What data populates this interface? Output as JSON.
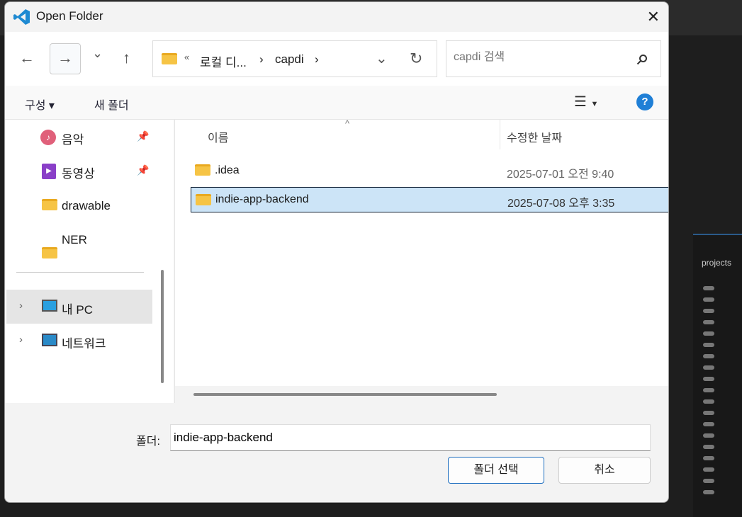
{
  "window": {
    "title": "Open Folder",
    "close": "✕"
  },
  "nav": {
    "back": "←",
    "forward": "→",
    "recent": "⌄",
    "up": "↑",
    "breadcrumb": [
      "«",
      "로컬 디...",
      "›",
      "capdi",
      "›"
    ],
    "search_placeholder": "capdi 검색"
  },
  "commandbar": {
    "organize": "구성 ▾",
    "new_folder": "새 폴더",
    "help": "?"
  },
  "sidebar": {
    "items": [
      {
        "label": "음악"
      },
      {
        "label": "동영상"
      },
      {
        "label": "drawable"
      },
      {
        "label": "NER"
      },
      {
        "label": "내 PC"
      },
      {
        "label": "네트워크"
      }
    ]
  },
  "columns": {
    "name": "이름",
    "modified": "수정한 날짜"
  },
  "files": [
    {
      "name": ".idea",
      "modified": "2025-07-01 오전 9:40"
    },
    {
      "name": "indie-app-backend",
      "modified": "2025-07-08 오후 3:35"
    }
  ],
  "footer": {
    "folder_label": "폴더:",
    "folder_value": "indie-app-backend",
    "select": "폴더 선택",
    "cancel": "취소"
  },
  "background": {
    "panel_title": "projects"
  }
}
